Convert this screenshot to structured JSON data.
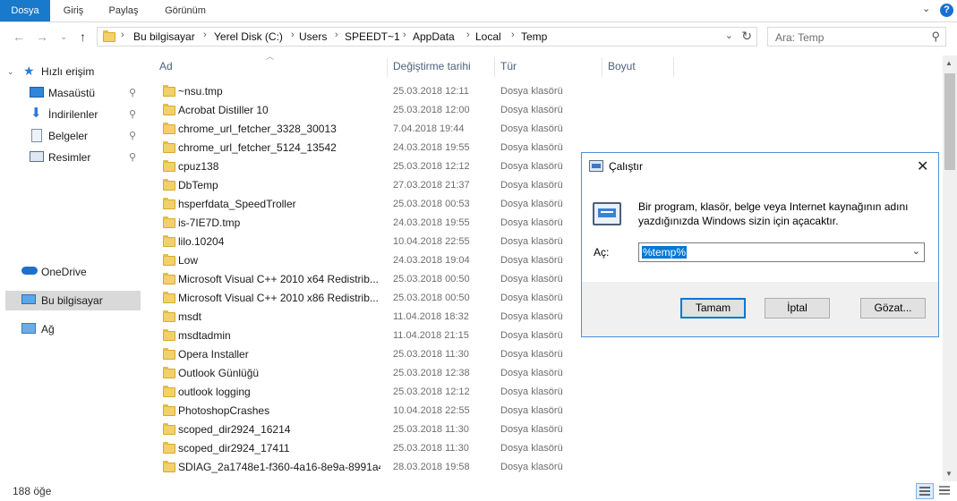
{
  "ribbon": {
    "tabs": [
      "Dosya",
      "Giriş",
      "Paylaş",
      "Görünüm"
    ]
  },
  "address": {
    "segments": [
      "Bu bilgisayar",
      "Yerel Disk (C:)",
      "Users",
      "SPEEDT~1",
      "AppData",
      "Local",
      "Temp"
    ]
  },
  "search": {
    "placeholder": "Ara: Temp"
  },
  "navpane": {
    "quick_access": "Hızlı erişim",
    "pinned": [
      "Masaüstü",
      "İndirilenler",
      "Belgeler",
      "Resimler"
    ],
    "onedrive": "OneDrive",
    "this_pc": "Bu bilgisayar",
    "network": "Ağ"
  },
  "columns": {
    "name": "Ad",
    "date": "Değiştirme tarihi",
    "type": "Tür",
    "size": "Boyut"
  },
  "files": [
    {
      "name": "~nsu.tmp",
      "date": "25.03.2018 12:11",
      "type": "Dosya klasörü"
    },
    {
      "name": "Acrobat Distiller 10",
      "date": "25.03.2018 12:00",
      "type": "Dosya klasörü"
    },
    {
      "name": "chrome_url_fetcher_3328_30013",
      "date": "7.04.2018 19:44",
      "type": "Dosya klasörü"
    },
    {
      "name": "chrome_url_fetcher_5124_13542",
      "date": "24.03.2018 19:55",
      "type": "Dosya klasörü"
    },
    {
      "name": "cpuz138",
      "date": "25.03.2018 12:12",
      "type": "Dosya klasörü"
    },
    {
      "name": "DbTemp",
      "date": "27.03.2018 21:37",
      "type": "Dosya klasörü"
    },
    {
      "name": "hsperfdata_SpeedTroller",
      "date": "25.03.2018 00:53",
      "type": "Dosya klasörü"
    },
    {
      "name": "is-7IE7D.tmp",
      "date": "24.03.2018 19:55",
      "type": "Dosya klasörü"
    },
    {
      "name": "lilo.10204",
      "date": "10.04.2018 22:55",
      "type": "Dosya klasörü"
    },
    {
      "name": "Low",
      "date": "24.03.2018 19:04",
      "type": "Dosya klasörü"
    },
    {
      "name": "Microsoft Visual C++ 2010  x64 Redistrib...",
      "date": "25.03.2018 00:50",
      "type": "Dosya klasörü"
    },
    {
      "name": "Microsoft Visual C++ 2010  x86 Redistrib...",
      "date": "25.03.2018 00:50",
      "type": "Dosya klasörü"
    },
    {
      "name": "msdt",
      "date": "11.04.2018 18:32",
      "type": "Dosya klasörü"
    },
    {
      "name": "msdtadmin",
      "date": "11.04.2018 21:15",
      "type": "Dosya klasörü"
    },
    {
      "name": "Opera Installer",
      "date": "25.03.2018 11:30",
      "type": "Dosya klasörü"
    },
    {
      "name": "Outlook Günlüğü",
      "date": "25.03.2018 12:38",
      "type": "Dosya klasörü"
    },
    {
      "name": "outlook logging",
      "date": "25.03.2018 12:12",
      "type": "Dosya klasörü"
    },
    {
      "name": "PhotoshopCrashes",
      "date": "10.04.2018 22:55",
      "type": "Dosya klasörü"
    },
    {
      "name": "scoped_dir2924_16214",
      "date": "25.03.2018 11:30",
      "type": "Dosya klasörü"
    },
    {
      "name": "scoped_dir2924_17411",
      "date": "25.03.2018 11:30",
      "type": "Dosya klasörü"
    },
    {
      "name": "SDIAG_2a1748e1-f360-4a16-8e9a-8991a4...",
      "date": "28.03.2018 19:58",
      "type": "Dosya klasörü"
    }
  ],
  "status": {
    "count": "188 öğe"
  },
  "run_dialog": {
    "title": "Çalıştır",
    "description": "Bir program, klasör, belge veya Internet kaynağının adını yazdığınızda Windows sizin için açacaktır.",
    "open_label": "Aç:",
    "open_value": "%temp%",
    "ok": "Tamam",
    "cancel": "İptal",
    "browse": "Gözat..."
  },
  "colors": {
    "accent": "#1979ca",
    "selection": "#0078d7",
    "folder": "#f4d06a"
  }
}
